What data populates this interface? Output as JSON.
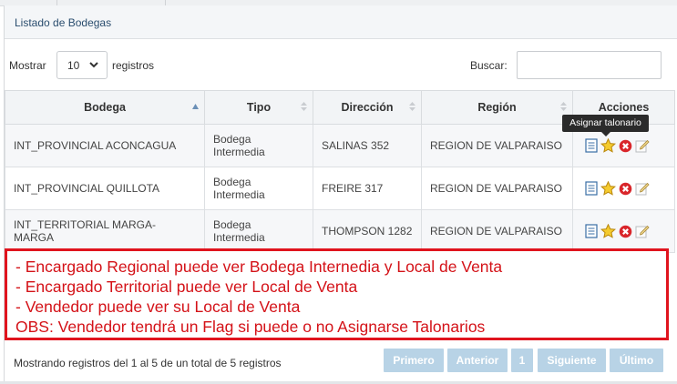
{
  "panel": {
    "title": "Listado de Bodegas"
  },
  "length_menu": {
    "label_before": "Mostrar",
    "value": "10",
    "label_after": "registros"
  },
  "search": {
    "label": "Buscar:",
    "value": ""
  },
  "table": {
    "columns": [
      "Bodega",
      "Tipo",
      "Dirección",
      "Región",
      "Acciones"
    ],
    "rows": [
      {
        "bodega": "INT_PROVINCIAL ACONCAGUA",
        "tipo": "Bodega Intermedia",
        "direccion": "SALINAS 352",
        "region": "REGION DE VALPARAISO"
      },
      {
        "bodega": "INT_PROVINCIAL QUILLOTA",
        "tipo": "Bodega Intermedia",
        "direccion": "FREIRE 317",
        "region": "REGION DE VALPARAISO"
      },
      {
        "bodega": "INT_TERRITORIAL MARGA-MARGA",
        "tipo": "Bodega Intermedia",
        "direccion": "THOMPSON 1282",
        "region": "REGION DE VALPARAISO"
      }
    ]
  },
  "tooltip": "Asignar talonario",
  "note": {
    "lines": [
      "- Encargado Regional puede ver Bodega Internedia y Local de Venta",
      "- Encargado Territorial puede ver Local de Venta",
      "- Vendedor puede ver su Local de Venta",
      "OBS: Vendedor tendrá un Flag si puede o no Asignarse Talonarios"
    ],
    "border_color": "#e0141e",
    "text_color": "#d41218"
  },
  "info": "Mostrando registros del 1 al 5 de un total de 5 registros",
  "pagination": {
    "first": "Primero",
    "prev": "Anterior",
    "page": "1",
    "next": "Siguiente",
    "last": "Último"
  },
  "icons": {
    "detail": "document-icon",
    "assign": "star-icon",
    "delete": "delete-x-icon",
    "edit": "edit-pencil-icon"
  }
}
